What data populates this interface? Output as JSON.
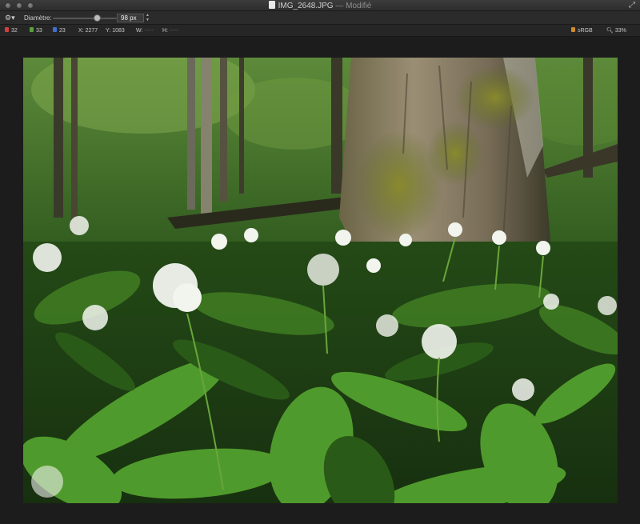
{
  "window": {
    "title": "IMG_2648.JPG",
    "modified_suffix": "— Modifié"
  },
  "toolbar": {
    "diameter_label": "Diamètre:",
    "diameter_value": "98 px",
    "slider_fraction": 0.67
  },
  "info_bar": {
    "r_label": "R",
    "r_value": "32",
    "g_label": "G",
    "g_value": "33",
    "b_label": "B",
    "b_value": "23",
    "x_label": "X:",
    "x_value": "2277",
    "y_label": "Y:",
    "y_value": "1083",
    "w_label": "W:",
    "w_value": "-----",
    "h_label": "H:",
    "h_value": "-----",
    "color_profile": "sRGB",
    "zoom": "33%"
  },
  "colors": {
    "r_chip": "#d04040",
    "g_chip": "#5aa040",
    "b_chip": "#4070d0",
    "profile_chip": "#d08a30"
  },
  "icons": {
    "gear": "gear-icon",
    "fullscreen": "fullscreen-icon",
    "document": "document-icon",
    "zoom": "magnifier-icon"
  }
}
